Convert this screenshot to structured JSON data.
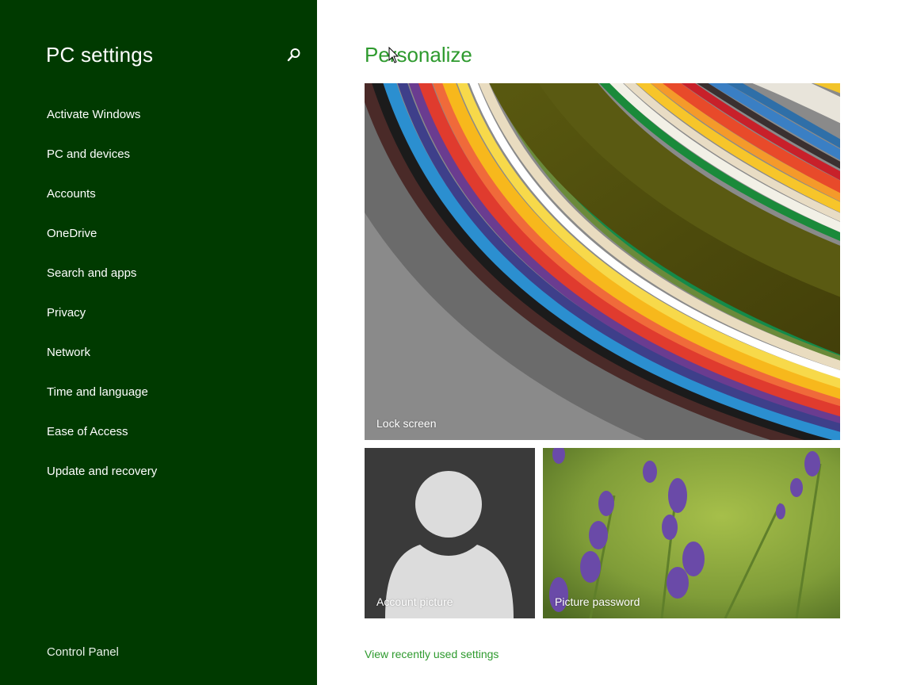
{
  "sidebar": {
    "title": "PC settings",
    "search_icon": "search-icon",
    "items": [
      {
        "label": "Activate Windows"
      },
      {
        "label": "PC and devices"
      },
      {
        "label": "Accounts"
      },
      {
        "label": "OneDrive"
      },
      {
        "label": "Search and apps"
      },
      {
        "label": "Privacy"
      },
      {
        "label": "Network"
      },
      {
        "label": "Time and language"
      },
      {
        "label": "Ease of Access"
      },
      {
        "label": "Update and recovery"
      }
    ],
    "footer_link": "Control Panel"
  },
  "main": {
    "title": "Personalize",
    "tiles": {
      "lock_screen": "Lock screen",
      "account_picture": "Account picture",
      "picture_password": "Picture password"
    },
    "recent_link": "View recently used settings"
  },
  "colors": {
    "sidebar_bg": "#003a00",
    "accent": "#2e9a2e",
    "account_tile_bg": "#3a3a3a"
  }
}
